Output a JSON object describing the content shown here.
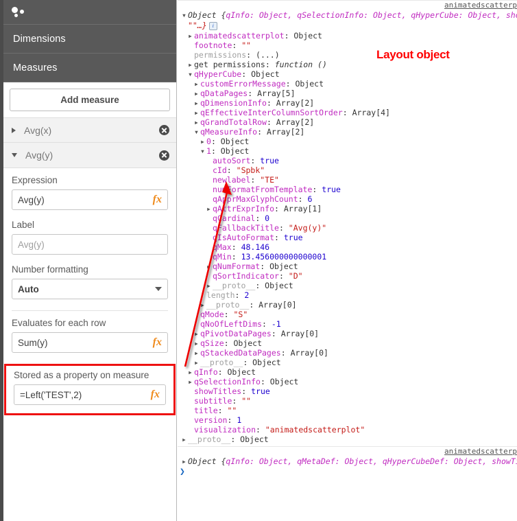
{
  "left_panel": {
    "logo_icon": "scatter-plot-icon",
    "sections": [
      {
        "label": "Dimensions"
      },
      {
        "label": "Measures"
      }
    ],
    "add_measure_label": "Add measure",
    "measures": [
      {
        "name": "Avg(x)",
        "expanded": false
      },
      {
        "name": "Avg(y)",
        "expanded": true
      }
    ],
    "expression": {
      "label": "Expression",
      "value": "Avg(y)",
      "fx_icon": "fx-icon"
    },
    "label_field": {
      "label": "Label",
      "placeholder": "Avg(y)",
      "value": ""
    },
    "number_formatting": {
      "label": "Number formatting",
      "value": "Auto"
    },
    "evaluates_each_row": {
      "label": "Evaluates for each row",
      "value": "Sum(y)",
      "fx_icon": "fx-icon"
    },
    "stored_property": {
      "label": "Stored as a property on measure",
      "value": "=Left('TEST',2)",
      "fx_icon": "fx-icon",
      "highlight_color": "#ee1111"
    }
  },
  "annotation": {
    "layout_object_label": "Layout object",
    "color": "#ff0000"
  },
  "console": {
    "source_link_top": "animatedscatterp",
    "source_link_bottom": "animatedscatterp",
    "layout_header": {
      "prefix": "Object {",
      "parts": "qInfo: Object, qSelectionInfo: Object, qHyperCube: Object, sho",
      "wrap": "\"\"…}"
    },
    "def_header": {
      "prefix": "Object {",
      "parts": "qInfo: Object, qMetaDef: Object, qHyperCubeDef: Object, showTi"
    },
    "prompt": "❯",
    "tree": [
      {
        "indent": 1,
        "tri": "closed",
        "key": "animatedscatterplot",
        "keyclass": "k",
        "sep": ": ",
        "value": "Object",
        "valclass": "v-obj"
      },
      {
        "indent": 1,
        "tri": "none",
        "key": "footnote",
        "keyclass": "k",
        "sep": ": ",
        "value": "\"\"",
        "valclass": "v-str"
      },
      {
        "indent": 1,
        "tri": "none",
        "key": "permissions",
        "keyclass": "k-dim",
        "sep": ": ",
        "value": "(...)",
        "valclass": "v-obj"
      },
      {
        "indent": 1,
        "tri": "closed",
        "key": "get permissions",
        "keyclass": "k-dark",
        "sep": ": ",
        "value": "function ()",
        "valclass": "v-fn"
      },
      {
        "indent": 1,
        "tri": "open",
        "key": "qHyperCube",
        "keyclass": "k",
        "sep": ": ",
        "value": "Object",
        "valclass": "v-obj"
      },
      {
        "indent": 2,
        "tri": "closed",
        "key": "customErrorMessage",
        "keyclass": "k",
        "sep": ": ",
        "value": "Object",
        "valclass": "v-obj"
      },
      {
        "indent": 2,
        "tri": "closed",
        "key": "qDataPages",
        "keyclass": "k",
        "sep": ": ",
        "value": "Array[5]",
        "valclass": "v-obj"
      },
      {
        "indent": 2,
        "tri": "closed",
        "key": "qDimensionInfo",
        "keyclass": "k",
        "sep": ": ",
        "value": "Array[2]",
        "valclass": "v-obj"
      },
      {
        "indent": 2,
        "tri": "closed",
        "key": "qEffectiveInterColumnSortOrder",
        "keyclass": "k",
        "sep": ": ",
        "value": "Array[4]",
        "valclass": "v-obj"
      },
      {
        "indent": 2,
        "tri": "closed",
        "key": "qGrandTotalRow",
        "keyclass": "k",
        "sep": ": ",
        "value": "Array[2]",
        "valclass": "v-obj"
      },
      {
        "indent": 2,
        "tri": "open",
        "key": "qMeasureInfo",
        "keyclass": "k",
        "sep": ": ",
        "value": "Array[2]",
        "valclass": "v-obj"
      },
      {
        "indent": 3,
        "tri": "closed",
        "key": "0",
        "keyclass": "k",
        "sep": ": ",
        "value": "Object",
        "valclass": "v-obj"
      },
      {
        "indent": 3,
        "tri": "open",
        "key": "1",
        "keyclass": "k",
        "sep": ": ",
        "value": "Object",
        "valclass": "v-obj"
      },
      {
        "indent": 4,
        "tri": "none",
        "key": "autoSort",
        "keyclass": "k",
        "sep": ": ",
        "value": "true",
        "valclass": "v-bool"
      },
      {
        "indent": 4,
        "tri": "none",
        "key": "cId",
        "keyclass": "k",
        "sep": ": ",
        "value": "\"Spbk\"",
        "valclass": "v-str"
      },
      {
        "indent": 4,
        "tri": "none",
        "key": "newlabel",
        "keyclass": "k",
        "sep": ": ",
        "value": "\"TE\"",
        "valclass": "v-str"
      },
      {
        "indent": 4,
        "tri": "none",
        "key": "numFormatFromTemplate",
        "keyclass": "k",
        "sep": ": ",
        "value": "true",
        "valclass": "v-bool"
      },
      {
        "indent": 4,
        "tri": "none",
        "key": "qApprMaxGlyphCount",
        "keyclass": "k",
        "sep": ": ",
        "value": "6",
        "valclass": "v-num"
      },
      {
        "indent": 4,
        "tri": "closed",
        "key": "qAttrExprInfo",
        "keyclass": "k",
        "sep": ": ",
        "value": "Array[1]",
        "valclass": "v-obj"
      },
      {
        "indent": 4,
        "tri": "none",
        "key": "qCardinal",
        "keyclass": "k",
        "sep": ": ",
        "value": "0",
        "valclass": "v-num"
      },
      {
        "indent": 4,
        "tri": "none",
        "key": "qFallbackTitle",
        "keyclass": "k",
        "sep": ": ",
        "value": "\"Avg(y)\"",
        "valclass": "v-str"
      },
      {
        "indent": 4,
        "tri": "none",
        "key": "qIsAutoFormat",
        "keyclass": "k",
        "sep": ": ",
        "value": "true",
        "valclass": "v-bool"
      },
      {
        "indent": 4,
        "tri": "none",
        "key": "qMax",
        "keyclass": "k",
        "sep": ": ",
        "value": "48.146",
        "valclass": "v-num"
      },
      {
        "indent": 4,
        "tri": "none",
        "key": "qMin",
        "keyclass": "k",
        "sep": ": ",
        "value": "13.456000000000001",
        "valclass": "v-num"
      },
      {
        "indent": 4,
        "tri": "closed",
        "key": "qNumFormat",
        "keyclass": "k",
        "sep": ": ",
        "value": "Object",
        "valclass": "v-obj"
      },
      {
        "indent": 4,
        "tri": "none",
        "key": "qSortIndicator",
        "keyclass": "k",
        "sep": ": ",
        "value": "\"D\"",
        "valclass": "v-str"
      },
      {
        "indent": 4,
        "tri": "closed",
        "key": "__proto__",
        "keyclass": "k-dim",
        "sep": ": ",
        "value": "Object",
        "valclass": "v-obj"
      },
      {
        "indent": 3,
        "tri": "none",
        "key": "length",
        "keyclass": "k-dim",
        "sep": ": ",
        "value": "2",
        "valclass": "v-num"
      },
      {
        "indent": 3,
        "tri": "closed",
        "key": "__proto__",
        "keyclass": "k-dim",
        "sep": ": ",
        "value": "Array[0]",
        "valclass": "v-obj"
      },
      {
        "indent": 2,
        "tri": "none",
        "key": "qMode",
        "keyclass": "k",
        "sep": ": ",
        "value": "\"S\"",
        "valclass": "v-str"
      },
      {
        "indent": 2,
        "tri": "none",
        "key": "qNoOfLeftDims",
        "keyclass": "k",
        "sep": ": ",
        "value": "-1",
        "valclass": "v-num"
      },
      {
        "indent": 2,
        "tri": "closed",
        "key": "qPivotDataPages",
        "keyclass": "k",
        "sep": ": ",
        "value": "Array[0]",
        "valclass": "v-obj"
      },
      {
        "indent": 2,
        "tri": "closed",
        "key": "qSize",
        "keyclass": "k",
        "sep": ": ",
        "value": "Object",
        "valclass": "v-obj"
      },
      {
        "indent": 2,
        "tri": "closed",
        "key": "qStackedDataPages",
        "keyclass": "k",
        "sep": ": ",
        "value": "Array[0]",
        "valclass": "v-obj"
      },
      {
        "indent": 2,
        "tri": "closed",
        "key": "__proto__",
        "keyclass": "k-dim",
        "sep": ": ",
        "value": "Object",
        "valclass": "v-obj"
      },
      {
        "indent": 1,
        "tri": "closed",
        "key": "qInfo",
        "keyclass": "k",
        "sep": ": ",
        "value": "Object",
        "valclass": "v-obj"
      },
      {
        "indent": 1,
        "tri": "closed",
        "key": "qSelectionInfo",
        "keyclass": "k",
        "sep": ": ",
        "value": "Object",
        "valclass": "v-obj"
      },
      {
        "indent": 1,
        "tri": "none",
        "key": "showTitles",
        "keyclass": "k",
        "sep": ": ",
        "value": "true",
        "valclass": "v-bool"
      },
      {
        "indent": 1,
        "tri": "none",
        "key": "subtitle",
        "keyclass": "k",
        "sep": ": ",
        "value": "\"\"",
        "valclass": "v-str"
      },
      {
        "indent": 1,
        "tri": "none",
        "key": "title",
        "keyclass": "k",
        "sep": ": ",
        "value": "\"\"",
        "valclass": "v-str"
      },
      {
        "indent": 1,
        "tri": "none",
        "key": "version",
        "keyclass": "k",
        "sep": ": ",
        "value": "1",
        "valclass": "v-num"
      },
      {
        "indent": 1,
        "tri": "none",
        "key": "visualization",
        "keyclass": "k",
        "sep": ": ",
        "value": "\"animatedscatterplot\"",
        "valclass": "v-str"
      },
      {
        "indent": 0,
        "tri": "closed",
        "key": "__proto__",
        "keyclass": "k-dim",
        "sep": ": ",
        "value": "Object",
        "valclass": "v-obj"
      }
    ]
  }
}
